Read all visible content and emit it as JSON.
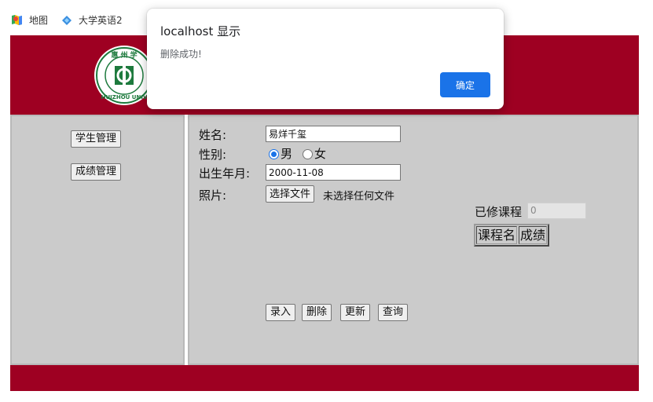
{
  "bookmarks": [
    {
      "label": "地图",
      "icon": "maps-icon"
    },
    {
      "label": "大学英语2",
      "icon": "diamond-icon"
    }
  ],
  "sidebar": {
    "student_mgmt": "学生管理",
    "grade_mgmt": "成绩管理"
  },
  "form": {
    "name_label": "姓名:",
    "name_value": "易烊千玺",
    "gender_label": "性别:",
    "gender_options": [
      "男",
      "女"
    ],
    "gender_selected": "男",
    "birth_label": "出生年月:",
    "birth_value": "2000-11-08",
    "photo_label": "照片:",
    "file_button": "选择文件",
    "file_status": "未选择任何文件"
  },
  "courses": {
    "label": "已修课程",
    "value": "0",
    "headers": [
      "课程名",
      "成绩"
    ]
  },
  "actions": {
    "add": "录入",
    "delete": "删除",
    "update": "更新",
    "query": "查询"
  },
  "dialog": {
    "title": "localhost 显示",
    "message": "删除成功!",
    "ok": "确定"
  },
  "colors": {
    "brand_red": "#9e0022",
    "panel_gray": "#cbcbcb",
    "dialog_button": "#1a73e8"
  }
}
